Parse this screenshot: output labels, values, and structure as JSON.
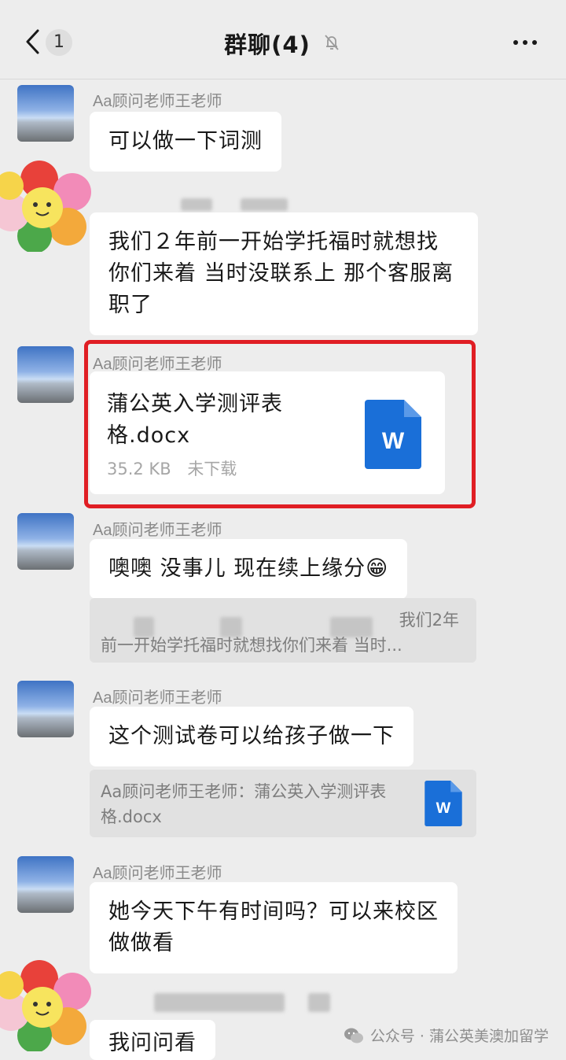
{
  "header": {
    "unread_badge": "1",
    "title": "群聊(4)",
    "icons": [
      "back-chevron-icon",
      "mute-bell-icon",
      "more-icon"
    ]
  },
  "messages": [
    {
      "sender": "Aa顾问老师王老师",
      "text": "可以做一下词测"
    },
    {
      "text": "我们２年前一开始学托福时就想找你们来着 当时没联系上 那个客服离职了"
    },
    {
      "sender": "Aa顾问老师王老师",
      "file": {
        "name": "蒲公英入学测评表格.docx",
        "size": "35.2 KB",
        "status": "未下载",
        "icon_letter": "W"
      }
    },
    {
      "sender": "Aa顾问老师王老师",
      "text": "噢噢 没事儿 现在续上缘分😁",
      "quote": {
        "line1": "我们2年",
        "line2": "前一开始学托福时就想找你们来着 当时..."
      }
    },
    {
      "sender": "Aa顾问老师王老师",
      "text": "这个测试卷可以给孩子做一下",
      "quote": {
        "text": "Aa顾问老师王老师：蒲公英入学测评表格.docx",
        "icon_letter": "W"
      }
    },
    {
      "sender": "Aa顾问老师王老师",
      "text": "她今天下午有时间吗？可以来校区做做看"
    },
    {
      "text": "我问问看"
    }
  ],
  "watermark": {
    "text": "公众号 · 蒲公英美澳加留学",
    "icon": "wechat-icon"
  },
  "colors": {
    "background": "#ededed",
    "bubble": "#ffffff",
    "highlight": "#e01e24",
    "word_blue": "#1a6fd8"
  }
}
